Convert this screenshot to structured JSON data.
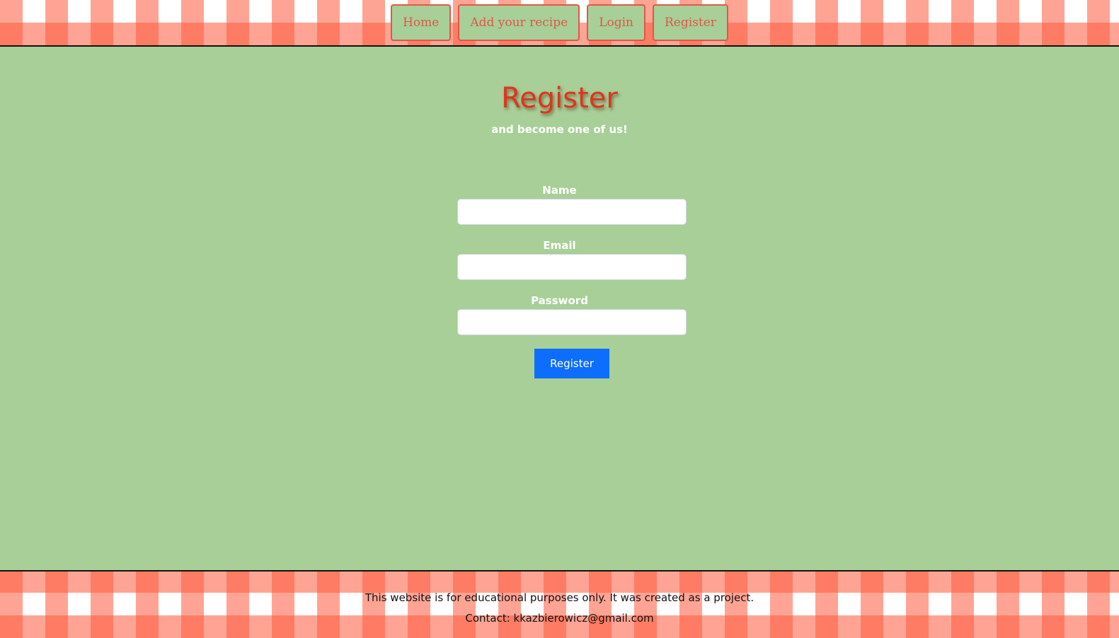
{
  "nav": {
    "items": [
      {
        "label": "Home"
      },
      {
        "label": "Add your recipe"
      },
      {
        "label": "Login"
      },
      {
        "label": "Register"
      }
    ]
  },
  "main": {
    "title": "Register",
    "subtitle": "and become one of us!",
    "form": {
      "name_label": "Name",
      "name_value": "",
      "email_label": "Email",
      "email_value": "",
      "password_label": "Password",
      "password_value": "",
      "submit_label": "Register"
    }
  },
  "footer": {
    "line1": "This website is for educational purposes only. It was created as a project.",
    "line2": "Contact: kkazbierowicz@gmail.com"
  },
  "colors": {
    "page_background": "#a7cf97",
    "accent_red": "#e0574a",
    "title_red": "#e0341e",
    "submit_blue": "#0d6efd"
  }
}
